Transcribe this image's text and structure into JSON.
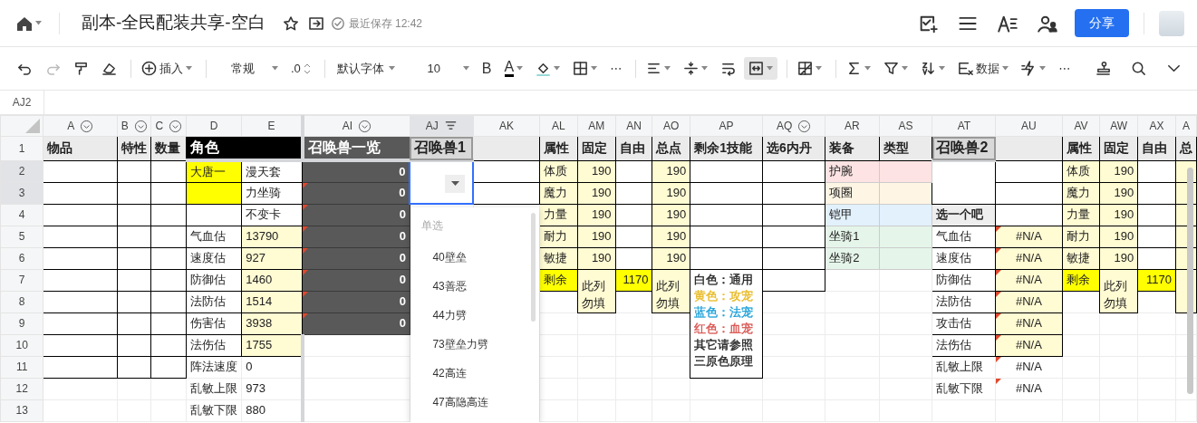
{
  "header": {
    "title": "副本-全民配装共享-空白",
    "save_status": "最近保存 12:42",
    "share_button": "分享"
  },
  "toolbar": {
    "groups": [
      [
        {
          "kind": "undo",
          "caret": false,
          "disabled": false,
          "active": false
        },
        {
          "kind": "redo",
          "caret": false,
          "disabled": true,
          "active": false
        },
        {
          "kind": "painter",
          "caret": false,
          "disabled": false,
          "active": false
        },
        {
          "kind": "eraser",
          "caret": false,
          "disabled": false,
          "active": false
        }
      ],
      [
        {
          "kind": "insert",
          "label": "插入",
          "caret": true,
          "disabled": false,
          "active": false
        }
      ],
      [
        {
          "kind": "select",
          "label": "常规",
          "caret": true,
          "disabled": false,
          "active": false
        },
        {
          "kind": "decimal",
          "label": ".0",
          "caret": false,
          "disabled": false,
          "active": false
        }
      ],
      [
        {
          "kind": "select",
          "label": "默认字体",
          "caret": true,
          "disabled": false,
          "active": false
        },
        {
          "kind": "select",
          "label": "10",
          "caret": true,
          "disabled": false,
          "active": false
        },
        {
          "kind": "bold",
          "label": "B",
          "caret": false,
          "disabled": false,
          "active": false
        },
        {
          "kind": "font-color",
          "label": "A",
          "caret": true,
          "disabled": false,
          "active": false
        },
        {
          "kind": "fill",
          "caret": true,
          "disabled": false,
          "active": false
        },
        {
          "kind": "borders",
          "caret": true,
          "disabled": false,
          "active": false
        },
        {
          "kind": "more",
          "label": "⋯",
          "caret": false,
          "disabled": false,
          "active": false
        }
      ],
      [
        {
          "kind": "align",
          "caret": true,
          "disabled": false,
          "active": false
        },
        {
          "kind": "valign",
          "caret": true,
          "disabled": false,
          "active": false
        },
        {
          "kind": "wrap",
          "caret": false,
          "disabled": false,
          "active": false
        },
        {
          "kind": "merge",
          "caret": true,
          "disabled": false,
          "active": true
        }
      ],
      [
        {
          "kind": "table",
          "caret": true,
          "disabled": false,
          "active": false
        }
      ],
      [
        {
          "kind": "sum",
          "caret": true,
          "disabled": false,
          "active": false
        },
        {
          "kind": "filter",
          "caret": true,
          "disabled": false,
          "active": false
        },
        {
          "kind": "sort",
          "caret": true,
          "disabled": false,
          "active": false
        },
        {
          "kind": "data",
          "label": "数据",
          "caret": true,
          "disabled": false,
          "active": false
        },
        {
          "kind": "flash",
          "caret": true,
          "disabled": false,
          "active": false
        },
        {
          "kind": "more",
          "label": "⋯",
          "caret": false,
          "disabled": false,
          "active": false
        }
      ]
    ]
  },
  "name_box": "AJ2",
  "sheet": {
    "columns": [
      {
        "label": "A",
        "selected": false,
        "filter": true,
        "filtered": false
      },
      {
        "label": "B",
        "selected": false,
        "filter": true,
        "filtered": false
      },
      {
        "label": "C",
        "selected": false,
        "filter": true,
        "filtered": false
      },
      {
        "label": "D",
        "selected": false,
        "filter": false,
        "filtered": false
      },
      {
        "label": "E",
        "selected": false,
        "filter": false,
        "filtered": false
      },
      {
        "label": "AI",
        "selected": false,
        "filter": true,
        "filtered": false
      },
      {
        "label": "AJ",
        "selected": true,
        "filter": true,
        "filtered": true
      },
      {
        "label": "AK",
        "selected": false,
        "filter": false,
        "filtered": false
      },
      {
        "label": "AL",
        "selected": false,
        "filter": false,
        "filtered": false
      },
      {
        "label": "AM",
        "selected": false,
        "filter": false,
        "filtered": false
      },
      {
        "label": "AN",
        "selected": false,
        "filter": false,
        "filtered": false
      },
      {
        "label": "AO",
        "selected": false,
        "filter": false,
        "filtered": false
      },
      {
        "label": "AP",
        "selected": false,
        "filter": false,
        "filtered": false
      },
      {
        "label": "AQ",
        "selected": false,
        "filter": true,
        "filtered": false
      },
      {
        "label": "AR",
        "selected": false,
        "filter": false,
        "filtered": false
      },
      {
        "label": "AS",
        "selected": false,
        "filter": false,
        "filtered": false
      },
      {
        "label": "AT",
        "selected": false,
        "filter": false,
        "filtered": false
      },
      {
        "label": "AU",
        "selected": false,
        "filter": false,
        "filtered": false
      },
      {
        "label": "AV",
        "selected": false,
        "filter": false,
        "filtered": false
      },
      {
        "label": "AW",
        "selected": false,
        "filter": false,
        "filtered": false
      },
      {
        "label": "AX",
        "selected": false,
        "filter": false,
        "filtered": false
      },
      {
        "label": "A",
        "selected": false,
        "filter": false,
        "filtered": false
      }
    ],
    "rows": [
      {
        "label": "1",
        "selected": false,
        "cells": [
          {
            "kind": "header",
            "text": "物品"
          },
          {
            "kind": "header",
            "text": "特性"
          },
          {
            "kind": "header",
            "text": "数量"
          },
          {
            "kind": "black-title",
            "text": "角色",
            "colspan": 2
          },
          {
            "kind": "dark-title",
            "text": "召唤兽一览"
          },
          {
            "kind": "grey-title",
            "text": "召唤兽1"
          },
          {
            "kind": "header"
          },
          {
            "kind": "header",
            "text": "属性"
          },
          {
            "kind": "header",
            "text": "固定"
          },
          {
            "kind": "header",
            "text": "自由"
          },
          {
            "kind": "header",
            "text": "总点"
          },
          {
            "kind": "header",
            "text": "剩余1技能"
          },
          {
            "kind": "header",
            "text": "选6内丹"
          },
          {
            "kind": "header",
            "text": "装备"
          },
          {
            "kind": "header",
            "text": "类型"
          },
          {
            "kind": "grey-title",
            "text": "召唤兽2"
          },
          {
            "kind": "header"
          },
          {
            "kind": "header",
            "text": "属性"
          },
          {
            "kind": "header",
            "text": "固定"
          },
          {
            "kind": "header",
            "text": "自由"
          },
          {
            "kind": "header",
            "text": "总"
          }
        ]
      },
      {
        "label": "2",
        "selected": true,
        "cells": [
          {
            "kind": "box"
          },
          {
            "kind": "box"
          },
          {
            "kind": "box"
          },
          {
            "kind": "yellow",
            "text": "大唐一"
          },
          {
            "kind": "box",
            "text": "漫天套"
          },
          {
            "kind": "dark",
            "text": "0"
          },
          {
            "kind": "dropdown",
            "rowspan": 2,
            "selected": true
          },
          {
            "kind": "box"
          },
          {
            "kind": "pale",
            "text": "体质"
          },
          {
            "kind": "pale",
            "text": "190"
          },
          {
            "kind": "box"
          },
          {
            "kind": "pale",
            "text": "190"
          },
          {
            "kind": "box"
          },
          {
            "kind": "box"
          },
          {
            "kind": "pink",
            "text": "护腕"
          },
          {
            "kind": "pink"
          },
          {
            "kind": "box",
            "rowspan": 2
          },
          {
            "kind": "box"
          },
          {
            "kind": "pale",
            "text": "体质"
          },
          {
            "kind": "pale",
            "text": "190"
          },
          {
            "kind": "box"
          },
          {
            "kind": "pale"
          }
        ]
      },
      {
        "label": "3",
        "selected": true,
        "cells": [
          {
            "kind": "box"
          },
          {
            "kind": "box"
          },
          {
            "kind": "box"
          },
          {
            "kind": "yellow"
          },
          {
            "kind": "box",
            "text": "力坐骑"
          },
          {
            "kind": "dark",
            "text": "0",
            "comment": true
          },
          {
            "kind": "box"
          },
          {
            "kind": "pale",
            "text": "魔力"
          },
          {
            "kind": "pale",
            "text": "190"
          },
          {
            "kind": "box"
          },
          {
            "kind": "pale",
            "text": "190"
          },
          {
            "kind": "box"
          },
          {
            "kind": "box"
          },
          {
            "kind": "cream",
            "text": "项圈"
          },
          {
            "kind": "cream"
          },
          {
            "kind": "box"
          },
          {
            "kind": "pale",
            "text": "魔力"
          },
          {
            "kind": "pale",
            "text": "190"
          },
          {
            "kind": "box"
          },
          {
            "kind": "pale"
          }
        ]
      },
      {
        "label": "4",
        "selected": false,
        "cells": [
          {
            "kind": "box"
          },
          {
            "kind": "box"
          },
          {
            "kind": "box"
          },
          {
            "kind": "box"
          },
          {
            "kind": "box",
            "text": "不变卡"
          },
          {
            "kind": "dark",
            "text": "0",
            "comment": true
          },
          {
            "kind": "blank"
          },
          {
            "kind": "blank"
          },
          {
            "kind": "pale",
            "text": "力量"
          },
          {
            "kind": "pale",
            "text": "190"
          },
          {
            "kind": "box"
          },
          {
            "kind": "pale",
            "text": "190"
          },
          {
            "kind": "box"
          },
          {
            "kind": "box"
          },
          {
            "kind": "blue",
            "text": "铠甲"
          },
          {
            "kind": "blue"
          },
          {
            "kind": "label",
            "text": "选一个吧"
          },
          {
            "kind": "box"
          },
          {
            "kind": "pale",
            "text": "力量"
          },
          {
            "kind": "pale",
            "text": "190"
          },
          {
            "kind": "box"
          },
          {
            "kind": "pale"
          }
        ]
      },
      {
        "label": "5",
        "selected": false,
        "cells": [
          {
            "kind": "box"
          },
          {
            "kind": "box"
          },
          {
            "kind": "box"
          },
          {
            "kind": "box",
            "text": "气血估"
          },
          {
            "kind": "pale",
            "text": "13790"
          },
          {
            "kind": "dark",
            "text": "0",
            "comment": true
          },
          {
            "kind": "blank"
          },
          {
            "kind": "blank"
          },
          {
            "kind": "pale",
            "text": "耐力"
          },
          {
            "kind": "pale",
            "text": "190"
          },
          {
            "kind": "box"
          },
          {
            "kind": "pale",
            "text": "190"
          },
          {
            "kind": "box"
          },
          {
            "kind": "box"
          },
          {
            "kind": "green",
            "text": "坐骑1"
          },
          {
            "kind": "green"
          },
          {
            "kind": "box",
            "text": "气血估"
          },
          {
            "kind": "pale",
            "text": "#N/A",
            "comment": true
          },
          {
            "kind": "pale",
            "text": "耐力"
          },
          {
            "kind": "pale",
            "text": "190"
          },
          {
            "kind": "box"
          },
          {
            "kind": "pale"
          }
        ]
      },
      {
        "label": "6",
        "selected": false,
        "cells": [
          {
            "kind": "box"
          },
          {
            "kind": "box"
          },
          {
            "kind": "box"
          },
          {
            "kind": "box",
            "text": "速度估"
          },
          {
            "kind": "pale",
            "text": "927"
          },
          {
            "kind": "dark",
            "text": "0",
            "comment": true
          },
          {
            "kind": "blank"
          },
          {
            "kind": "blank"
          },
          {
            "kind": "pale",
            "text": "敏捷"
          },
          {
            "kind": "pale",
            "text": "190"
          },
          {
            "kind": "box"
          },
          {
            "kind": "pale",
            "text": "190"
          },
          {
            "kind": "box"
          },
          {
            "kind": "box"
          },
          {
            "kind": "green",
            "text": "坐骑2"
          },
          {
            "kind": "green"
          },
          {
            "kind": "box",
            "text": "速度估"
          },
          {
            "kind": "pale",
            "text": "#N/A",
            "comment": true
          },
          {
            "kind": "pale",
            "text": "敏捷"
          },
          {
            "kind": "pale",
            "text": "190"
          },
          {
            "kind": "box"
          },
          {
            "kind": "pale"
          }
        ]
      },
      {
        "label": "7",
        "selected": false,
        "cells": [
          {
            "kind": "box"
          },
          {
            "kind": "box"
          },
          {
            "kind": "box"
          },
          {
            "kind": "box",
            "text": "防御估"
          },
          {
            "kind": "pale",
            "text": "1460"
          },
          {
            "kind": "dark",
            "text": "0",
            "comment": true
          },
          {
            "kind": "blank"
          },
          {
            "kind": "blank"
          },
          {
            "kind": "yellow",
            "text": "剩余"
          },
          {
            "kind": "hint",
            "text": "此列勿填",
            "rowspan": 2
          },
          {
            "kind": "yellow",
            "text": "1170"
          },
          {
            "kind": "hint",
            "text": "此列勿填",
            "rowspan": 2
          },
          {
            "kind": "legend",
            "rowspan": 5,
            "lines": [
              {
                "text": "白色：通用",
                "color": "#222222"
              },
              {
                "text": "黄色：攻宠",
                "color": "#e8b923"
              },
              {
                "text": "蓝色：法宠",
                "color": "#1ca0d8"
              },
              {
                "text": "红色：血宠",
                "color": "#d9534f"
              },
              {
                "text": "其它请参照",
                "color": "#222222"
              },
              {
                "text": "三原色原理",
                "color": "#222222"
              }
            ]
          },
          {
            "kind": "box"
          },
          {
            "kind": "blank"
          },
          {
            "kind": "blank"
          },
          {
            "kind": "box",
            "text": "防御估"
          },
          {
            "kind": "pale",
            "text": "#N/A",
            "comment": true
          },
          {
            "kind": "yellow",
            "text": "剩余"
          },
          {
            "kind": "hint",
            "text": "此列勿填",
            "rowspan": 2
          },
          {
            "kind": "yellow",
            "text": "1170"
          },
          {
            "kind": "hint",
            "rowspan": 2
          }
        ]
      },
      {
        "label": "8",
        "selected": false,
        "cells": [
          {
            "kind": "box"
          },
          {
            "kind": "box"
          },
          {
            "kind": "box"
          },
          {
            "kind": "box",
            "text": "法防估"
          },
          {
            "kind": "pale",
            "text": "1514"
          },
          {
            "kind": "dark",
            "text": "0",
            "comment": true
          },
          {
            "kind": "blank"
          },
          {
            "kind": "blank"
          },
          {
            "kind": "blank"
          },
          {
            "kind": "blank"
          },
          {
            "kind": "blank"
          },
          {
            "kind": "blank"
          },
          {
            "kind": "blank"
          },
          {
            "kind": "box",
            "text": "法防估"
          },
          {
            "kind": "pale",
            "text": "#N/A",
            "comment": true
          },
          {
            "kind": "blank"
          },
          {
            "kind": "blank"
          }
        ]
      },
      {
        "label": "9",
        "selected": false,
        "cells": [
          {
            "kind": "box"
          },
          {
            "kind": "box"
          },
          {
            "kind": "box"
          },
          {
            "kind": "box",
            "text": "伤害估"
          },
          {
            "kind": "pale",
            "text": "3938"
          },
          {
            "kind": "dark",
            "text": "0",
            "comment": true
          },
          {
            "kind": "blank"
          },
          {
            "kind": "blank"
          },
          {
            "kind": "blank"
          },
          {
            "kind": "blank"
          },
          {
            "kind": "blank"
          },
          {
            "kind": "blank"
          },
          {
            "kind": "blank"
          },
          {
            "kind": "blank"
          },
          {
            "kind": "blank"
          },
          {
            "kind": "box",
            "text": "攻击估"
          },
          {
            "kind": "pale",
            "text": "#N/A",
            "comment": true
          },
          {
            "kind": "blank"
          },
          {
            "kind": "blank"
          },
          {
            "kind": "blank"
          },
          {
            "kind": "blank"
          }
        ]
      },
      {
        "label": "10",
        "selected": false,
        "cells": [
          {
            "kind": "box"
          },
          {
            "kind": "box"
          },
          {
            "kind": "box"
          },
          {
            "kind": "box",
            "text": "法伤估"
          },
          {
            "kind": "pale",
            "text": "1755"
          },
          {
            "kind": "blank"
          },
          {
            "kind": "blank"
          },
          {
            "kind": "blank"
          },
          {
            "kind": "blank"
          },
          {
            "kind": "blank"
          },
          {
            "kind": "blank"
          },
          {
            "kind": "blank"
          },
          {
            "kind": "blank"
          },
          {
            "kind": "blank"
          },
          {
            "kind": "blank"
          },
          {
            "kind": "box",
            "text": "法伤估"
          },
          {
            "kind": "pale",
            "text": "#N/A",
            "comment": true
          },
          {
            "kind": "blank"
          },
          {
            "kind": "blank"
          },
          {
            "kind": "blank"
          },
          {
            "kind": "blank"
          }
        ]
      },
      {
        "label": "11",
        "selected": false,
        "cells": [
          {
            "kind": "box"
          },
          {
            "kind": "box"
          },
          {
            "kind": "box"
          },
          {
            "kind": "plain",
            "text": "阵法速度"
          },
          {
            "kind": "plain",
            "text": "0"
          },
          {
            "kind": "blank"
          },
          {
            "kind": "blank"
          },
          {
            "kind": "blank"
          },
          {
            "kind": "blank"
          },
          {
            "kind": "blank"
          },
          {
            "kind": "blank"
          },
          {
            "kind": "blank"
          },
          {
            "kind": "blank"
          },
          {
            "kind": "blank"
          },
          {
            "kind": "blank"
          },
          {
            "kind": "plain",
            "text": "乱敏上限"
          },
          {
            "kind": "plain",
            "text": "#N/A",
            "comment": true
          },
          {
            "kind": "blank"
          },
          {
            "kind": "blank"
          },
          {
            "kind": "blank"
          },
          {
            "kind": "blank"
          }
        ]
      },
      {
        "label": "12",
        "selected": false,
        "cells": [
          {
            "kind": "blank"
          },
          {
            "kind": "blank"
          },
          {
            "kind": "blank"
          },
          {
            "kind": "plain",
            "text": "乱敏上限"
          },
          {
            "kind": "plain",
            "text": "973"
          },
          {
            "kind": "blank"
          },
          {
            "kind": "blank"
          },
          {
            "kind": "blank"
          },
          {
            "kind": "blank"
          },
          {
            "kind": "blank"
          },
          {
            "kind": "blank"
          },
          {
            "kind": "blank"
          },
          {
            "kind": "blank"
          },
          {
            "kind": "blank"
          },
          {
            "kind": "blank"
          },
          {
            "kind": "blank"
          },
          {
            "kind": "plain",
            "text": "乱敏下限"
          },
          {
            "kind": "plain",
            "text": "#N/A",
            "comment": true
          },
          {
            "kind": "blank"
          },
          {
            "kind": "blank"
          },
          {
            "kind": "blank"
          },
          {
            "kind": "blank"
          }
        ]
      },
      {
        "label": "13",
        "selected": false,
        "cells": [
          {
            "kind": "blank"
          },
          {
            "kind": "blank"
          },
          {
            "kind": "blank"
          },
          {
            "kind": "plain",
            "text": "乱敏下限"
          },
          {
            "kind": "plain",
            "text": "880"
          },
          {
            "kind": "blank"
          },
          {
            "kind": "blank"
          },
          {
            "kind": "blank"
          },
          {
            "kind": "blank"
          },
          {
            "kind": "blank"
          },
          {
            "kind": "blank"
          },
          {
            "kind": "blank"
          },
          {
            "kind": "blank"
          },
          {
            "kind": "blank"
          },
          {
            "kind": "blank"
          },
          {
            "kind": "blank"
          },
          {
            "kind": "blank"
          },
          {
            "kind": "blank"
          },
          {
            "kind": "blank"
          },
          {
            "kind": "blank"
          },
          {
            "kind": "blank"
          },
          {
            "kind": "blank"
          }
        ]
      }
    ],
    "dropdown": {
      "header": "单选",
      "options": [
        {
          "text": "40壁垒",
          "selected": false
        },
        {
          "text": "43善恶",
          "selected": false
        },
        {
          "text": "44力劈",
          "selected": false
        },
        {
          "text": "73壁垒力劈",
          "selected": false
        },
        {
          "text": "42高连",
          "selected": false
        },
        {
          "text": "47高隐高连",
          "selected": false
        }
      ]
    }
  }
}
